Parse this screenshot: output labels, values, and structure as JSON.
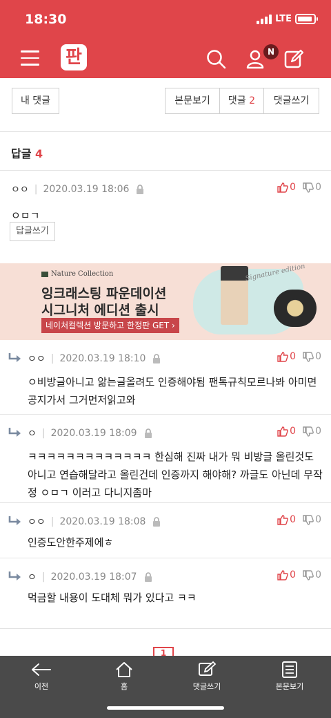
{
  "status": {
    "time": "18:30",
    "network": "LTE",
    "battery_level": 0.9
  },
  "header": {
    "logo": "판",
    "badge": "N",
    "accent": "#e0454a"
  },
  "buttons": {
    "my_comments": "내 댓글",
    "view_post": "본문보기",
    "comments_label": "댓글",
    "comments_count": "2",
    "write_comment": "댓글쓰기"
  },
  "replies": {
    "title": "답글",
    "count": "4"
  },
  "main_comment": {
    "author": "ㅇㅇ",
    "date": "2020.03.19 18:06",
    "body": "ㅇㅁㄱ",
    "up": "0",
    "down": "0",
    "reply_button": "답글쓰기"
  },
  "ad": {
    "brand": "Nature Collection",
    "line1": "잉크래스팅 파운데이션",
    "line2": "시그니처 에디션 출시",
    "cta": "네이처컬렉션 방문하고 한정판 GET ›",
    "script": "Signature edition"
  },
  "comments": [
    {
      "author": "ㅇㅇ",
      "date": "2020.03.19 18:10",
      "body": "ㅇ비방글아니고 앎는글올려도 인증해야됨 팬톡규칙모르나봐 아미면 공지가서 그거먼저읽고와",
      "up": "0",
      "down": "0"
    },
    {
      "author": "ㅇ",
      "date": "2020.03.19 18:09",
      "body": "ㅋㅋㅋㅋㅋㅋㅋㅋㅋㅋㅋㅋㅋ 한심해 진짜 내가 뭐 비방글 올린것도 아니고 연습해달라고 올린건데 인증까지 해야해? 까글도 아닌데 무작정 ㅇㅁㄱ 이러고 다니지좀마",
      "up": "0",
      "down": "0"
    },
    {
      "author": "ㅇㅇ",
      "date": "2020.03.19 18:08",
      "body": "인증도안한주제에ㅎ",
      "up": "0",
      "down": "0"
    },
    {
      "author": "ㅇ",
      "date": "2020.03.19 18:07",
      "body": "먹금할 내용이 도대체 뭐가 있다고 ㅋㅋ",
      "up": "0",
      "down": "0"
    }
  ],
  "pagination": {
    "current": "1"
  },
  "tabbar": {
    "prev": "이전",
    "home": "홈",
    "write": "댓글쓰기",
    "view_post": "본문보기"
  }
}
